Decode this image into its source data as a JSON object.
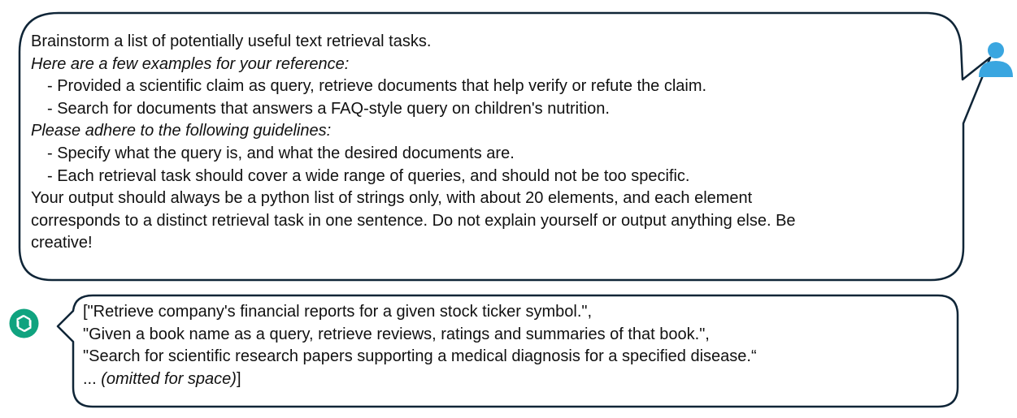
{
  "user_message": {
    "lines": [
      {
        "text": "Brainstorm a list of potentially useful text retrieval tasks.",
        "style": "normal"
      },
      {
        "text": "Here are a few examples for your reference:",
        "style": "italic"
      },
      {
        "text": "- Provided a scientific claim as query, retrieve documents that help verify or refute the claim.",
        "style": "indent"
      },
      {
        "text": "- Search for documents that answers a FAQ-style query on children's nutrition.",
        "style": "indent"
      },
      {
        "text": "Please adhere to the following guidelines:",
        "style": "italic"
      },
      {
        "text": "- Specify what the query is, and what the desired documents are.",
        "style": "indent"
      },
      {
        "text": "- Each retrieval task should cover a wide range of queries, and should not be too specific.",
        "style": "indent"
      },
      {
        "text": "Your output should always be a python list of strings only, with about 20 elements, and each element",
        "style": "normal"
      },
      {
        "text": "corresponds to a distinct retrieval task in one sentence. Do not explain yourself or output anything else. Be",
        "style": "normal"
      },
      {
        "text": "creative!",
        "style": "normal"
      }
    ]
  },
  "assistant_message": {
    "lines": [
      "[\"Retrieve company's financial reports for a given stock ticker symbol.\",",
      "\"Given a book name as a query, retrieve reviews, ratings and summaries of that book.\",",
      "\"Search for scientific research papers supporting a medical diagnosis for a specified disease.“"
    ],
    "last_line_prefix": "... ",
    "last_line_italic": "(omitted for space)",
    "last_line_suffix": "]"
  },
  "icons": {
    "user": "user-avatar-icon",
    "assistant": "chatgpt-logo-icon"
  },
  "colors": {
    "bubble_border": "#0f2537",
    "user_avatar": "#3aa6e0",
    "assistant_avatar": "#10a37f"
  }
}
